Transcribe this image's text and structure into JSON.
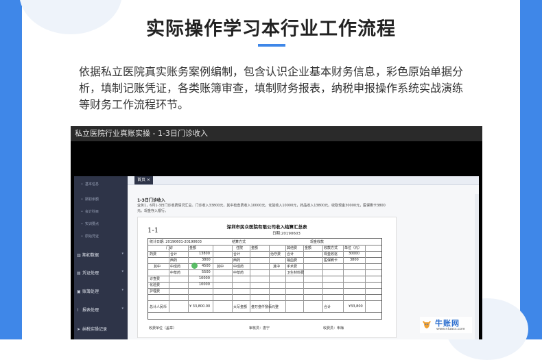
{
  "page": {
    "title": "实际操作学习本行业工作流程",
    "intro": "依据私立医院真实账务案例编制，包含认识企业基本财务信息，彩色原始单据分析，填制记账凭证，各类账簿审查，填制财务报表，纳税申报操作系统实战演练等财务工作流程环节。"
  },
  "video": {
    "title": "私立医院行业真账实操 - 1-3日门诊收入"
  },
  "app": {
    "sidebar": {
      "sub_items": [
        "基本信息",
        "期初余额",
        "会计科目",
        "实训要点",
        "原始凭证"
      ],
      "items": [
        {
          "label": "期初数据",
          "icon": "chart-icon"
        },
        {
          "label": "凭证处理",
          "icon": "document-icon"
        },
        {
          "label": "账簿处理",
          "icon": "book-icon"
        },
        {
          "label": "报表处理",
          "icon": "line-chart-icon"
        },
        {
          "label": "纳税实操记录",
          "icon": "send-icon"
        }
      ]
    },
    "tab": {
      "label": "首页 ×"
    },
    "task": {
      "title": "1-3日门诊收入",
      "description": "业务1，6月1-3日门诊收费情况汇总。门诊收入33800元，其中检查费收入10000元，化验收入10000元，药品收入13800元。收取现金30000元，医保刷卡3800元。现金存入银行。"
    },
    "document": {
      "number": "1-1",
      "title": "深圳市民众医院有限公司收入结算汇总表",
      "date": "日期:20190603",
      "period": "统计日期: 20190601-20190603",
      "settle_label": "结算方式",
      "cash_label": "现金收款",
      "headers": [
        "门诊",
        "住院",
        "其他费",
        "收款方式",
        "单位（元）"
      ],
      "sub_headers": [
        "金额",
        "金额",
        "金额",
        "金额"
      ],
      "rows_left": [
        {
          "name": "药费",
          "sub": "合计",
          "value": "13800"
        },
        {
          "name": "",
          "sub": "西药",
          "value": "3800"
        },
        {
          "name": "其中",
          "sub": "中成药",
          "value": "4500"
        },
        {
          "name": "",
          "sub": "中草药",
          "value": "5500"
        },
        {
          "name": "诊查费",
          "sub": "",
          "value": "10000"
        },
        {
          "name": "化验费",
          "sub": "",
          "value": "10000"
        },
        {
          "name": "护理费",
          "sub": "",
          "value": ""
        }
      ],
      "rows_mid": [
        "合计",
        "西药",
        "其中",
        "中成药",
        "中草药"
      ],
      "rows_other": [
        "治疗费",
        "合计",
        "输血费",
        "其中",
        "手术费",
        "卫生材料费"
      ],
      "payments": [
        {
          "method": "现金收迄",
          "amount": "30000"
        },
        {
          "method": "医保刷卡",
          "amount": "3800"
        }
      ],
      "total_label": "总计人民币",
      "total_value": "¥ 33,800.00",
      "capital_label": "大写金额",
      "capital_value": "叁万叁仟捌佰元整",
      "sum_label": "合计",
      "sum_value": "¥33,800",
      "footer": {
        "unit": "收费单位（盖章）",
        "reviewer": "审核员：唐宁",
        "cashier": "收费员：朱梅"
      }
    }
  },
  "watermark": {
    "brand": "牛账网",
    "url": "www.niuacc.com"
  },
  "colors": {
    "accent": "#3f87e8",
    "sidebar": "#2e3448",
    "brand": "#2d6fcf"
  }
}
